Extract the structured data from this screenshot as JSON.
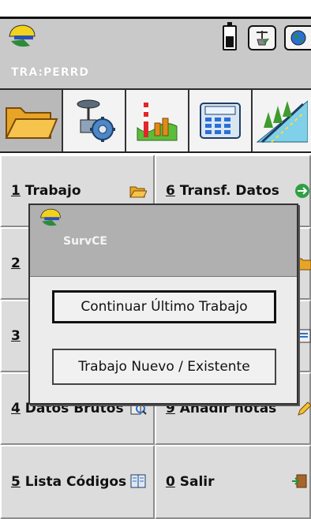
{
  "header": {
    "job_name": "TRA:PERRD",
    "status_icons": [
      "battery-icon",
      "satellite-receiver-icon",
      "globe-icon"
    ]
  },
  "tabs": [
    {
      "icon": "folder-icon",
      "active": true
    },
    {
      "icon": "equipment-gear-icon",
      "active": false
    },
    {
      "icon": "survey-chart-icon",
      "active": false
    },
    {
      "icon": "calculator-icon",
      "active": false
    },
    {
      "icon": "road-trees-icon",
      "active": false
    }
  ],
  "menu": [
    {
      "num": "1",
      "label": " Trabajo",
      "icon": "open-folder-icon"
    },
    {
      "num": "6",
      "label": " Transf. Datos",
      "icon": "transfer-icon"
    },
    {
      "num": "2",
      "label": "",
      "icon": ""
    },
    {
      "num": "",
      "label": "",
      "icon": "folder-icon"
    },
    {
      "num": "3",
      "label": "",
      "icon": ""
    },
    {
      "num": "",
      "label": "",
      "icon": "document-icon"
    },
    {
      "num": "4",
      "label": " Datos Brutos",
      "icon": "search-data-icon"
    },
    {
      "num": "9",
      "label": " Añadir notas",
      "icon": "pencil-icon"
    },
    {
      "num": "5",
      "label": " Lista Códigos",
      "icon": "code-book-icon"
    },
    {
      "num": "0",
      "label": " Salir",
      "icon": "exit-icon"
    }
  ],
  "dialog": {
    "title": "SurvCE",
    "continue_label": "Continuar Último Trabajo",
    "new_label": "Trabajo Nuevo / Existente"
  },
  "colors": {
    "header_bg": "#c9c9c9",
    "cell_bg": "#dcdcdc",
    "dialog_title_bg": "#b0b0b0",
    "logo_yellow": "#f2d21b",
    "logo_green": "#2e8b3a",
    "logo_blue": "#2a4fb5"
  }
}
